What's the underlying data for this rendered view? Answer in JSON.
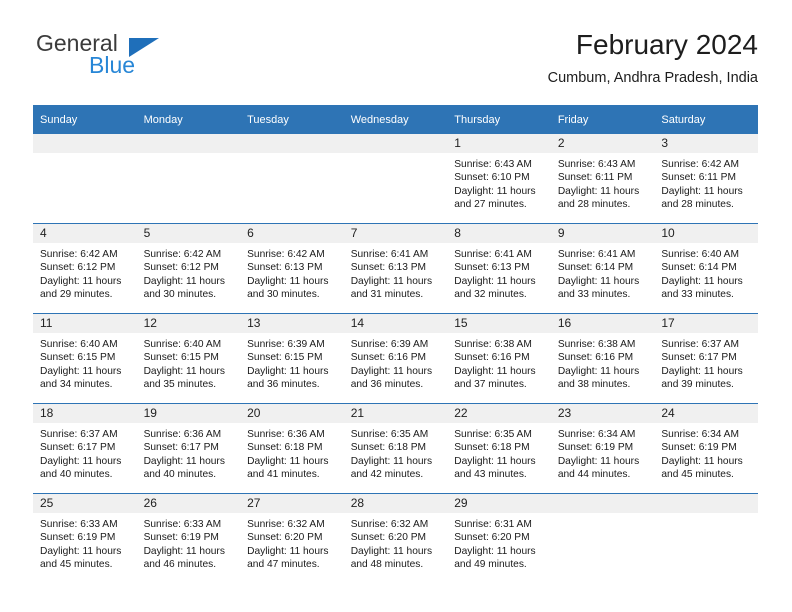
{
  "logo": {
    "word_one": "General",
    "word_two": "Blue",
    "triangle_color": "#1f6fba",
    "blue_color": "#2786d6",
    "gray_color": "#3b3b3b"
  },
  "header": {
    "title": "February 2024",
    "location": "Cumbum, Andhra Pradesh, India"
  },
  "theme": {
    "header_blue": "#2e74b5",
    "daynum_band": "#f0f0f0",
    "text": "#1a1a1a"
  },
  "weekdays": [
    "Sunday",
    "Monday",
    "Tuesday",
    "Wednesday",
    "Thursday",
    "Friday",
    "Saturday"
  ],
  "labels": {
    "sunrise_prefix": "Sunrise:",
    "sunset_prefix": "Sunset:",
    "daylight_prefix": "Daylight:"
  },
  "weeks": [
    [
      {
        "day": "",
        "blank": true,
        "sunrise": "",
        "sunset": "",
        "daylight_a": "",
        "daylight_b": ""
      },
      {
        "day": "",
        "blank": true,
        "sunrise": "",
        "sunset": "",
        "daylight_a": "",
        "daylight_b": ""
      },
      {
        "day": "",
        "blank": true,
        "sunrise": "",
        "sunset": "",
        "daylight_a": "",
        "daylight_b": ""
      },
      {
        "day": "",
        "blank": true,
        "sunrise": "",
        "sunset": "",
        "daylight_a": "",
        "daylight_b": ""
      },
      {
        "day": "1",
        "blank": false,
        "sunrise": "Sunrise: 6:43 AM",
        "sunset": "Sunset: 6:10 PM",
        "daylight_a": "Daylight: 11 hours",
        "daylight_b": "and 27 minutes."
      },
      {
        "day": "2",
        "blank": false,
        "sunrise": "Sunrise: 6:43 AM",
        "sunset": "Sunset: 6:11 PM",
        "daylight_a": "Daylight: 11 hours",
        "daylight_b": "and 28 minutes."
      },
      {
        "day": "3",
        "blank": false,
        "sunrise": "Sunrise: 6:42 AM",
        "sunset": "Sunset: 6:11 PM",
        "daylight_a": "Daylight: 11 hours",
        "daylight_b": "and 28 minutes."
      }
    ],
    [
      {
        "day": "4",
        "blank": false,
        "sunrise": "Sunrise: 6:42 AM",
        "sunset": "Sunset: 6:12 PM",
        "daylight_a": "Daylight: 11 hours",
        "daylight_b": "and 29 minutes."
      },
      {
        "day": "5",
        "blank": false,
        "sunrise": "Sunrise: 6:42 AM",
        "sunset": "Sunset: 6:12 PM",
        "daylight_a": "Daylight: 11 hours",
        "daylight_b": "and 30 minutes."
      },
      {
        "day": "6",
        "blank": false,
        "sunrise": "Sunrise: 6:42 AM",
        "sunset": "Sunset: 6:13 PM",
        "daylight_a": "Daylight: 11 hours",
        "daylight_b": "and 30 minutes."
      },
      {
        "day": "7",
        "blank": false,
        "sunrise": "Sunrise: 6:41 AM",
        "sunset": "Sunset: 6:13 PM",
        "daylight_a": "Daylight: 11 hours",
        "daylight_b": "and 31 minutes."
      },
      {
        "day": "8",
        "blank": false,
        "sunrise": "Sunrise: 6:41 AM",
        "sunset": "Sunset: 6:13 PM",
        "daylight_a": "Daylight: 11 hours",
        "daylight_b": "and 32 minutes."
      },
      {
        "day": "9",
        "blank": false,
        "sunrise": "Sunrise: 6:41 AM",
        "sunset": "Sunset: 6:14 PM",
        "daylight_a": "Daylight: 11 hours",
        "daylight_b": "and 33 minutes."
      },
      {
        "day": "10",
        "blank": false,
        "sunrise": "Sunrise: 6:40 AM",
        "sunset": "Sunset: 6:14 PM",
        "daylight_a": "Daylight: 11 hours",
        "daylight_b": "and 33 minutes."
      }
    ],
    [
      {
        "day": "11",
        "blank": false,
        "sunrise": "Sunrise: 6:40 AM",
        "sunset": "Sunset: 6:15 PM",
        "daylight_a": "Daylight: 11 hours",
        "daylight_b": "and 34 minutes."
      },
      {
        "day": "12",
        "blank": false,
        "sunrise": "Sunrise: 6:40 AM",
        "sunset": "Sunset: 6:15 PM",
        "daylight_a": "Daylight: 11 hours",
        "daylight_b": "and 35 minutes."
      },
      {
        "day": "13",
        "blank": false,
        "sunrise": "Sunrise: 6:39 AM",
        "sunset": "Sunset: 6:15 PM",
        "daylight_a": "Daylight: 11 hours",
        "daylight_b": "and 36 minutes."
      },
      {
        "day": "14",
        "blank": false,
        "sunrise": "Sunrise: 6:39 AM",
        "sunset": "Sunset: 6:16 PM",
        "daylight_a": "Daylight: 11 hours",
        "daylight_b": "and 36 minutes."
      },
      {
        "day": "15",
        "blank": false,
        "sunrise": "Sunrise: 6:38 AM",
        "sunset": "Sunset: 6:16 PM",
        "daylight_a": "Daylight: 11 hours",
        "daylight_b": "and 37 minutes."
      },
      {
        "day": "16",
        "blank": false,
        "sunrise": "Sunrise: 6:38 AM",
        "sunset": "Sunset: 6:16 PM",
        "daylight_a": "Daylight: 11 hours",
        "daylight_b": "and 38 minutes."
      },
      {
        "day": "17",
        "blank": false,
        "sunrise": "Sunrise: 6:37 AM",
        "sunset": "Sunset: 6:17 PM",
        "daylight_a": "Daylight: 11 hours",
        "daylight_b": "and 39 minutes."
      }
    ],
    [
      {
        "day": "18",
        "blank": false,
        "sunrise": "Sunrise: 6:37 AM",
        "sunset": "Sunset: 6:17 PM",
        "daylight_a": "Daylight: 11 hours",
        "daylight_b": "and 40 minutes."
      },
      {
        "day": "19",
        "blank": false,
        "sunrise": "Sunrise: 6:36 AM",
        "sunset": "Sunset: 6:17 PM",
        "daylight_a": "Daylight: 11 hours",
        "daylight_b": "and 40 minutes."
      },
      {
        "day": "20",
        "blank": false,
        "sunrise": "Sunrise: 6:36 AM",
        "sunset": "Sunset: 6:18 PM",
        "daylight_a": "Daylight: 11 hours",
        "daylight_b": "and 41 minutes."
      },
      {
        "day": "21",
        "blank": false,
        "sunrise": "Sunrise: 6:35 AM",
        "sunset": "Sunset: 6:18 PM",
        "daylight_a": "Daylight: 11 hours",
        "daylight_b": "and 42 minutes."
      },
      {
        "day": "22",
        "blank": false,
        "sunrise": "Sunrise: 6:35 AM",
        "sunset": "Sunset: 6:18 PM",
        "daylight_a": "Daylight: 11 hours",
        "daylight_b": "and 43 minutes."
      },
      {
        "day": "23",
        "blank": false,
        "sunrise": "Sunrise: 6:34 AM",
        "sunset": "Sunset: 6:19 PM",
        "daylight_a": "Daylight: 11 hours",
        "daylight_b": "and 44 minutes."
      },
      {
        "day": "24",
        "blank": false,
        "sunrise": "Sunrise: 6:34 AM",
        "sunset": "Sunset: 6:19 PM",
        "daylight_a": "Daylight: 11 hours",
        "daylight_b": "and 45 minutes."
      }
    ],
    [
      {
        "day": "25",
        "blank": false,
        "sunrise": "Sunrise: 6:33 AM",
        "sunset": "Sunset: 6:19 PM",
        "daylight_a": "Daylight: 11 hours",
        "daylight_b": "and 45 minutes."
      },
      {
        "day": "26",
        "blank": false,
        "sunrise": "Sunrise: 6:33 AM",
        "sunset": "Sunset: 6:19 PM",
        "daylight_a": "Daylight: 11 hours",
        "daylight_b": "and 46 minutes."
      },
      {
        "day": "27",
        "blank": false,
        "sunrise": "Sunrise: 6:32 AM",
        "sunset": "Sunset: 6:20 PM",
        "daylight_a": "Daylight: 11 hours",
        "daylight_b": "and 47 minutes."
      },
      {
        "day": "28",
        "blank": false,
        "sunrise": "Sunrise: 6:32 AM",
        "sunset": "Sunset: 6:20 PM",
        "daylight_a": "Daylight: 11 hours",
        "daylight_b": "and 48 minutes."
      },
      {
        "day": "29",
        "blank": false,
        "sunrise": "Sunrise: 6:31 AM",
        "sunset": "Sunset: 6:20 PM",
        "daylight_a": "Daylight: 11 hours",
        "daylight_b": "and 49 minutes."
      },
      {
        "day": "",
        "blank": true,
        "sunrise": "",
        "sunset": "",
        "daylight_a": "",
        "daylight_b": ""
      },
      {
        "day": "",
        "blank": true,
        "sunrise": "",
        "sunset": "",
        "daylight_a": "",
        "daylight_b": ""
      }
    ]
  ]
}
